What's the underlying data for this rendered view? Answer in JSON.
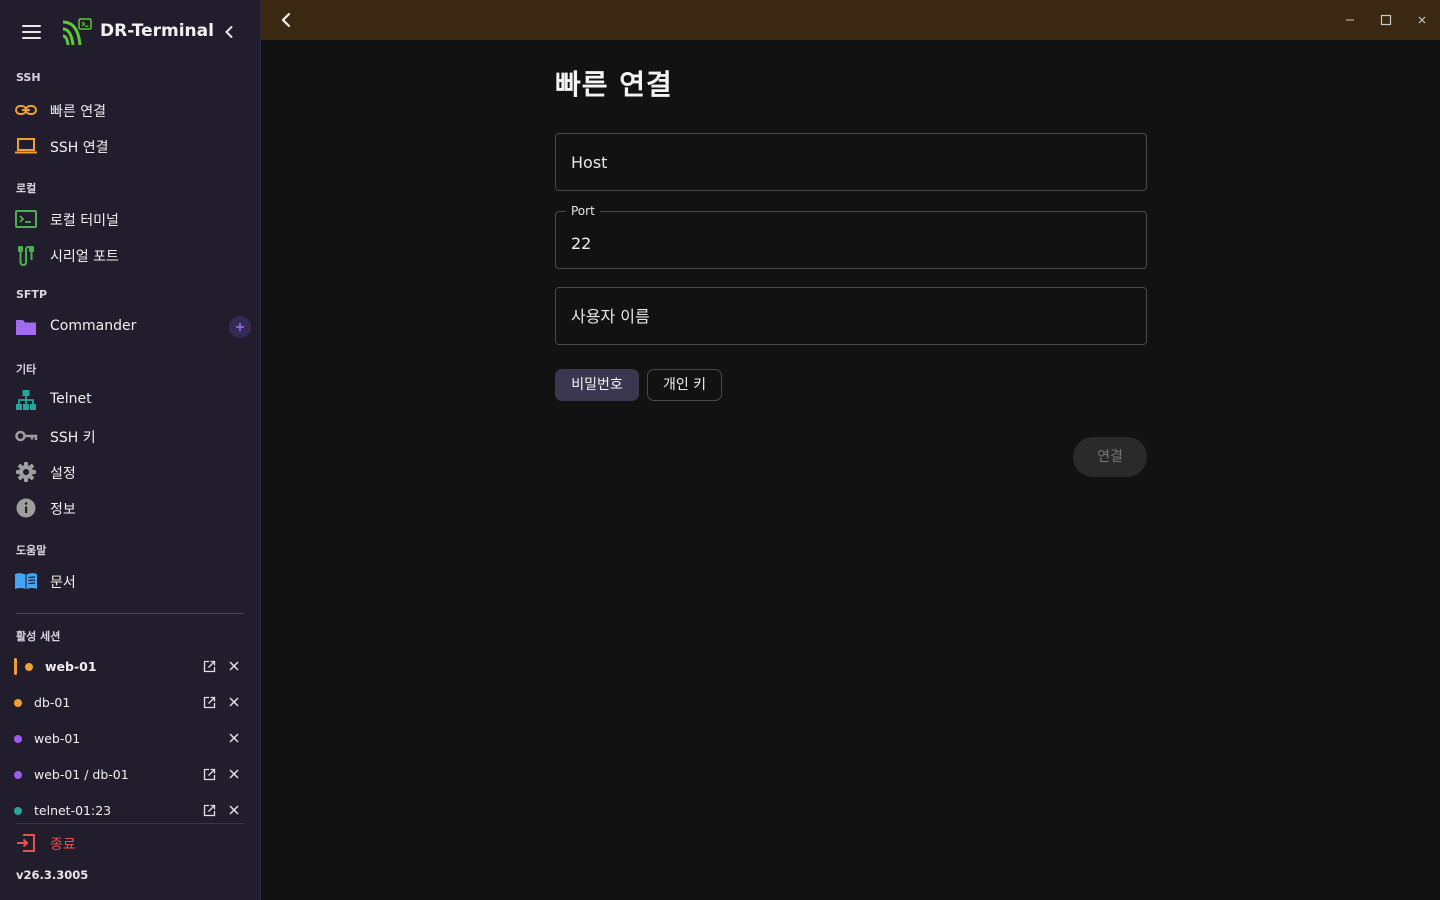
{
  "app": {
    "title": "DR-Terminal",
    "version": "v26.3.3005"
  },
  "colors": {
    "sidebar_bg": "#211d2c",
    "topbar_bg": "#3a2812",
    "main_bg": "#121212",
    "accent_green": "#4caf50",
    "accent_purple": "#9c5cf0",
    "accent_orange": "#f0a030",
    "accent_teal": "#26a69a",
    "danger": "#e85050"
  },
  "sidebar": {
    "sections": {
      "ssh": "SSH",
      "local": "로컬",
      "sftp": "SFTP",
      "etc": "기타",
      "help": "도움말",
      "sessions": "활성 세션"
    },
    "items": {
      "quick_connect": {
        "label": "빠른 연결",
        "icon": "link-icon"
      },
      "ssh_connect": {
        "label": "SSH 연결",
        "icon": "laptop-icon"
      },
      "local_terminal": {
        "label": "로컬 터미널",
        "icon": "terminal-icon"
      },
      "serial_port": {
        "label": "시리얼 포트",
        "icon": "serial-cable-icon"
      },
      "commander": {
        "label": "Commander",
        "icon": "folder-icon"
      },
      "telnet": {
        "label": "Telnet",
        "icon": "network-tree-icon"
      },
      "ssh_key": {
        "label": "SSH 키",
        "icon": "key-icon"
      },
      "settings": {
        "label": "설정",
        "icon": "gear-icon"
      },
      "info": {
        "label": "정보",
        "icon": "info-icon"
      },
      "docs": {
        "label": "문서",
        "icon": "book-icon"
      }
    },
    "active_sessions": [
      {
        "label": "web-01",
        "color": "#f0a030",
        "active": true,
        "popout": true
      },
      {
        "label": "db-01",
        "color": "#f0a030",
        "active": false,
        "popout": true
      },
      {
        "label": "web-01",
        "color": "#9c5cf0",
        "active": false,
        "popout": false
      },
      {
        "label": "web-01 / db-01",
        "color": "#9c5cf0",
        "active": false,
        "popout": true
      },
      {
        "label": "telnet-01:23",
        "color": "#26a69a",
        "active": false,
        "popout": true
      }
    ],
    "quit": {
      "label": "종료",
      "icon": "exit-icon"
    }
  },
  "main": {
    "title": "빠른 연결",
    "form": {
      "host": {
        "placeholder": "Host",
        "value": ""
      },
      "port": {
        "label": "Port",
        "value": "22"
      },
      "username": {
        "placeholder": "사용자 이름",
        "value": ""
      },
      "auth_options": [
        {
          "label": "비밀번호",
          "selected": true
        },
        {
          "label": "개인 키",
          "selected": false
        }
      ],
      "connect_label": "연결"
    }
  }
}
